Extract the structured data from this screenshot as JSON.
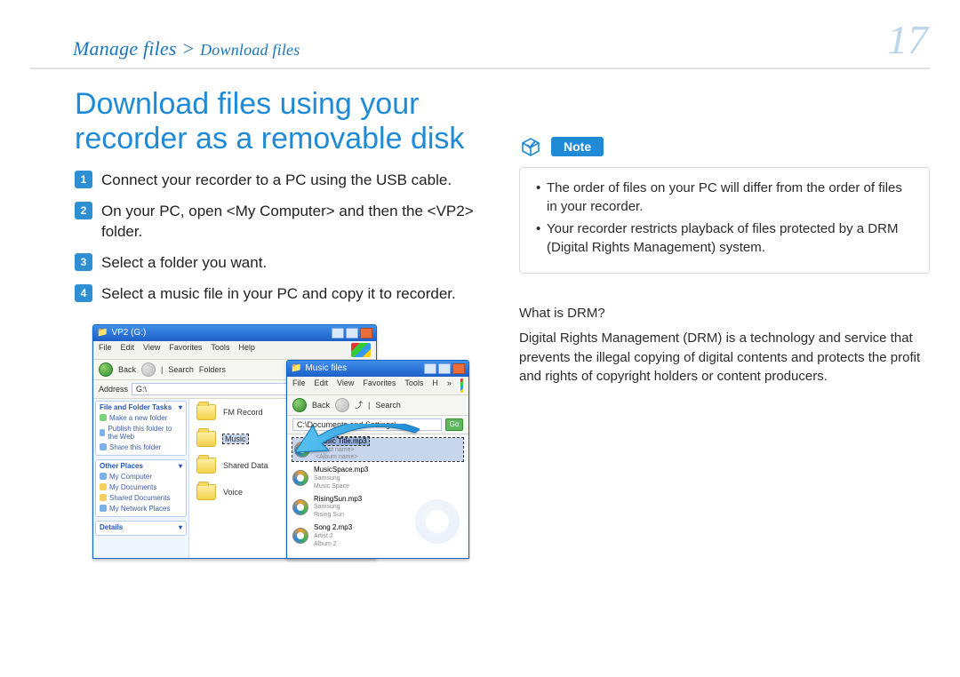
{
  "breadcrumb": {
    "main": "Manage files",
    "sep": ">",
    "sub": "Download files"
  },
  "page_number": "17",
  "title": "Download files using your recorder as a removable disk",
  "steps": [
    "Connect your recorder to a PC using the USB cable.",
    "On your PC, open <My Computer> and then the <VP2> folder.",
    "Select a folder you want.",
    "Select a music file in your PC and copy it to recorder."
  ],
  "win1": {
    "title": "VP2 (G:)",
    "menu": [
      "File",
      "Edit",
      "View",
      "Favorites",
      "Tools",
      "Help"
    ],
    "toolbar": {
      "back": "Back",
      "search": "Search",
      "folders": "Folders"
    },
    "address_label": "Address",
    "address_value": "G:\\",
    "side_groups": {
      "tasks": {
        "header": "File and Folder Tasks",
        "items": [
          "Make a new folder",
          "Publish this folder to the Web",
          "Share this folder"
        ]
      },
      "other": {
        "header": "Other Places",
        "items": [
          "My Computer",
          "My Documents",
          "Shared Documents",
          "My Network Places"
        ]
      },
      "details": {
        "header": "Details"
      }
    },
    "folders": [
      "FM Record",
      "Music",
      "Shared Data",
      "Voice"
    ],
    "selected_folder_index": 1
  },
  "win2": {
    "title": "Music files",
    "menu": [
      "File",
      "Edit",
      "View",
      "Favorites",
      "Tools",
      "H"
    ],
    "toolbar": {
      "back": "Back",
      "search": "Search"
    },
    "address_value": "C:\\Documents and Settings\\",
    "go": "Go",
    "tracks": [
      {
        "name": "Music Title.mp3",
        "line2": "<Artist name>",
        "line3": "<Album name>",
        "selected": true
      },
      {
        "name": "MusicSpace.mp3",
        "line2": "Samsung",
        "line3": "Music Space"
      },
      {
        "name": "RisingSun.mp3",
        "line2": "Samsung",
        "line3": "Rising Sun"
      },
      {
        "name": "Song 2.mp3",
        "line2": "Artist 2",
        "line3": "Album 2"
      }
    ]
  },
  "note_label": "Note",
  "note_items": [
    "The order of files on your PC will differ from the order of files in your recorder.",
    "Your recorder restricts playback of files protected by a DRM (Digital Rights Management) system."
  ],
  "drm": {
    "question": "What is DRM?",
    "answer": "Digital Rights Management (DRM) is a technology and service that prevents the illegal copying of digital contents and protects the profit and rights of copyright holders or content producers."
  }
}
